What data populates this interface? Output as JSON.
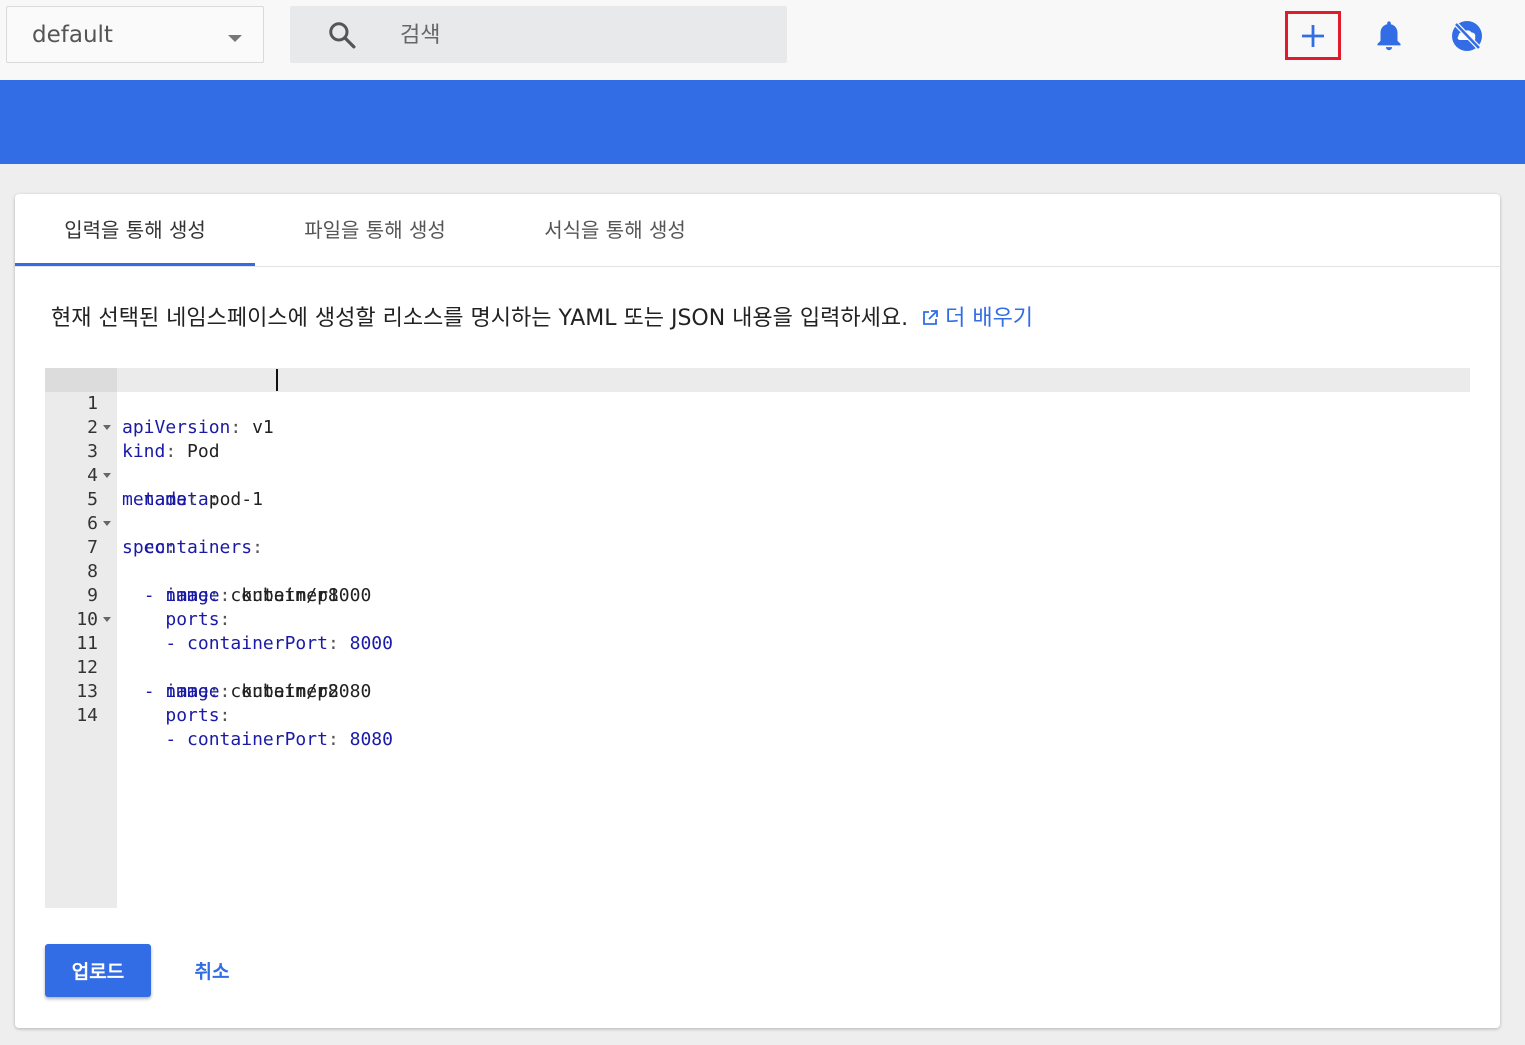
{
  "toolbar": {
    "namespace": "default",
    "search_placeholder": "검색",
    "add_icon": "plus-icon",
    "notifications_icon": "bell-icon",
    "cloud_icon": "cloud-off-icon"
  },
  "colors": {
    "brand_blue": "#326de6",
    "highlight_red": "#e21b2c"
  },
  "tabs": [
    {
      "label": "입력을 통해 생성",
      "active": true
    },
    {
      "label": "파일을 통해 생성",
      "active": false
    },
    {
      "label": "서식을 통해 생성",
      "active": false
    }
  ],
  "description": {
    "text": "현재 선택된 네임스페이스에 생성할 리소스를 명시하는 YAML 또는 JSON 내용을 입력하세요.",
    "link_label": "더 배우기"
  },
  "editor": {
    "lines": [
      {
        "n": "1",
        "key": "apiVersion",
        "value": "v1"
      },
      {
        "n": "2",
        "key": "kind",
        "value": "Pod"
      },
      {
        "n": "3",
        "key": "metadata",
        "value": ""
      },
      {
        "n": "4",
        "key": "name",
        "value": "pod-1"
      },
      {
        "n": "5",
        "key": "spec",
        "value": ""
      },
      {
        "n": "6",
        "key": "containers",
        "value": ""
      },
      {
        "n": "7",
        "key": "name",
        "value": "container1"
      },
      {
        "n": "8",
        "key": "image",
        "value": "kubetm/p8000"
      },
      {
        "n": "9",
        "key": "ports",
        "value": ""
      },
      {
        "n": "10",
        "key": "containerPort",
        "value": "8000"
      },
      {
        "n": "11",
        "key": "name",
        "value": "container2"
      },
      {
        "n": "12",
        "key": "image",
        "value": "kubetm/p8080"
      },
      {
        "n": "13",
        "key": "ports",
        "value": ""
      },
      {
        "n": "14",
        "key": "containerPort",
        "value": "8080"
      }
    ]
  },
  "actions": {
    "upload_label": "업로드",
    "cancel_label": "취소"
  }
}
